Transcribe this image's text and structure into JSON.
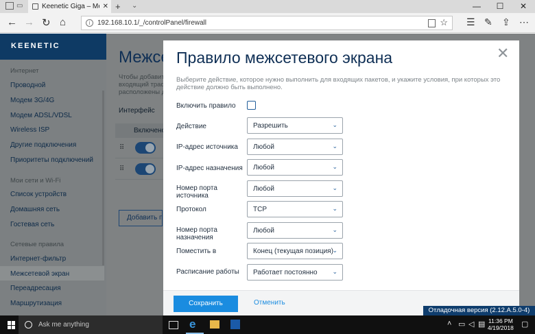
{
  "browser": {
    "tab_title": "Keenetic Giga – Межсе",
    "url": "192.168.10.1/_/controlPanel/firewall"
  },
  "brand": {
    "logo": "KEENETIC"
  },
  "sidebar": {
    "sections": [
      {
        "label": "Интернет"
      },
      {
        "label": "Мои сети и Wi-Fi"
      },
      {
        "label": "Сетевые правила"
      }
    ],
    "items": [
      {
        "label": "Проводной"
      },
      {
        "label": "Модем 3G/4G"
      },
      {
        "label": "Модем ADSL/VDSL"
      },
      {
        "label": "Wireless ISP"
      },
      {
        "label": "Другие подключения"
      },
      {
        "label": "Приоритеты подключений"
      },
      {
        "label": "Список устройств"
      },
      {
        "label": "Домашняя сеть"
      },
      {
        "label": "Гостевая сеть"
      },
      {
        "label": "Интернет-фильтр"
      },
      {
        "label": "Межсетевой экран"
      },
      {
        "label": "Переадресация"
      },
      {
        "label": "Маршрутизация"
      }
    ]
  },
  "content": {
    "title": "Межсе",
    "desc_line1": "Чтобы добавит",
    "desc_line2": "входящий траф",
    "desc_line3": "расположены д",
    "interface_label": "Интерфейс",
    "column_enabled": "Включено",
    "add_button": "Добавить пр"
  },
  "modal": {
    "title": "Правило межсетевого экрана",
    "description": "Выберите действие, которое нужно выполнить для входящих пакетов, и укажите условия, при которых это действие должно быть выполнено.",
    "enable_label": "Включить правило",
    "fields": [
      {
        "label": "Действие",
        "value": "Разрешить"
      },
      {
        "label": "IP-адрес источника",
        "value": "Любой"
      },
      {
        "label": "IP-адрес назначения",
        "value": "Любой"
      },
      {
        "label": "Номер порта источника",
        "value": "Любой"
      },
      {
        "label": "Протокол",
        "value": "TCP"
      },
      {
        "label": "Номер порта назначения",
        "value": "Любой"
      },
      {
        "label": "Поместить в",
        "value": "Конец (текущая позиция)"
      },
      {
        "label": "Расписание работы",
        "value": "Работает постоянно"
      }
    ],
    "save": "Сохранить",
    "cancel": "Отменить"
  },
  "debug_badge": "Отладочная версия (2.12.A.5.0-4)",
  "taskbar": {
    "search_placeholder": "Ask me anything",
    "time": "11:36 PM",
    "date": "4/19/2018"
  }
}
